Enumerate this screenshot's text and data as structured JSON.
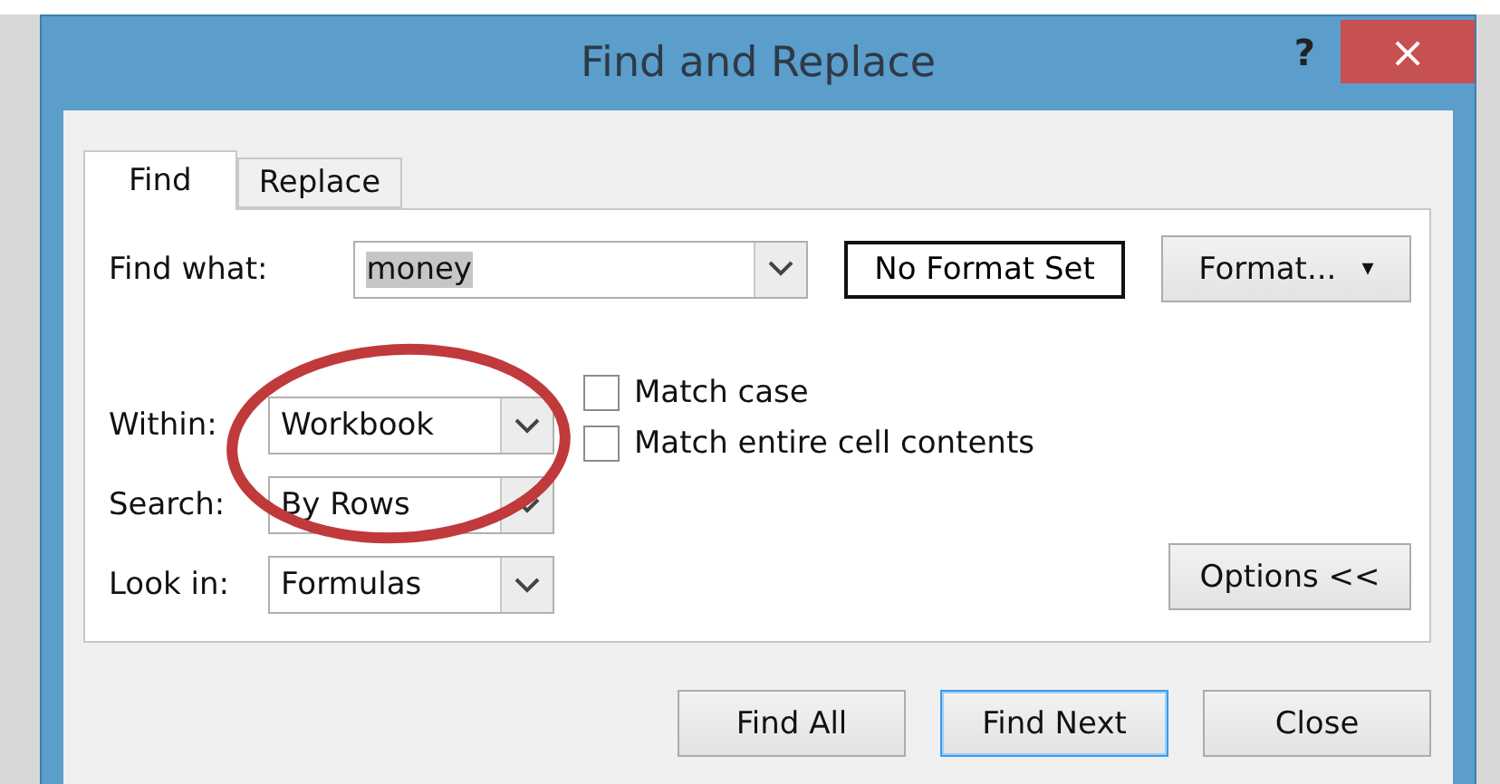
{
  "window": {
    "title": "Find and Replace",
    "help": "?",
    "close": "×"
  },
  "tabs": [
    {
      "label": "Find",
      "selected": true
    },
    {
      "label": "Replace",
      "selected": false
    }
  ],
  "find_what": {
    "label": "Find what:",
    "value": "money",
    "format_status": "No Format Set",
    "format_button": "Format...",
    "caret": "▾"
  },
  "options": [
    {
      "label": "Within:",
      "value": "Workbook"
    },
    {
      "label": "Search:",
      "value": "By Rows"
    },
    {
      "label": "Look in:",
      "value": "Formulas"
    }
  ],
  "checkboxes": [
    {
      "label": "Match case",
      "checked": false
    },
    {
      "label": "Match entire cell contents",
      "checked": false
    }
  ],
  "options_button": "Options <<",
  "buttons": [
    {
      "label": "Find All",
      "focused": false
    },
    {
      "label": "Find Next",
      "focused": true
    },
    {
      "label": "Close",
      "focused": false
    }
  ],
  "annotation": {
    "kind": "ellipse",
    "color": "#c0393b"
  }
}
